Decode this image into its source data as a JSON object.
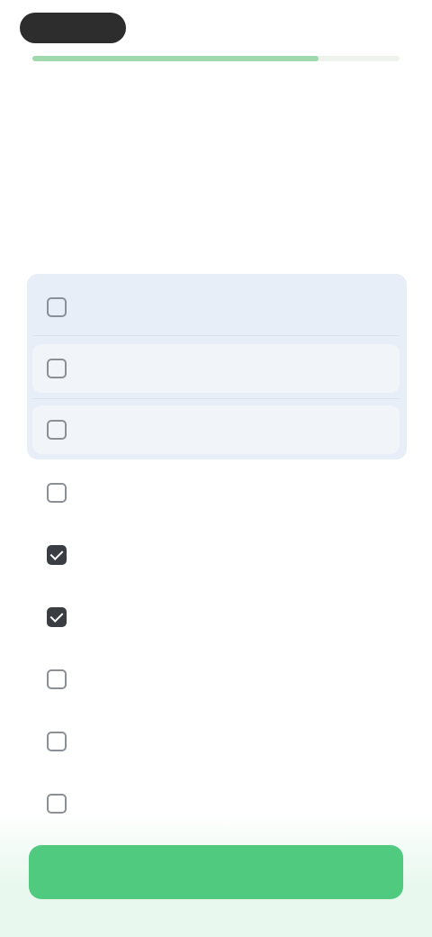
{
  "header": {
    "logo": "",
    "top_right": ""
  },
  "progress": {
    "value": 0.78
  },
  "overline": "",
  "title": "",
  "options": [
    {
      "label": "",
      "checked": false
    },
    {
      "label": "",
      "checked": false
    },
    {
      "label": "",
      "checked": false
    },
    {
      "label": "",
      "checked": false
    },
    {
      "label": "",
      "checked": true
    },
    {
      "label": "",
      "checked": true
    },
    {
      "label": "",
      "checked": false
    },
    {
      "label": "",
      "checked": false
    },
    {
      "label": "",
      "checked": false
    }
  ],
  "cta": {
    "label": ""
  },
  "colors": {
    "accent": "#4fca7f",
    "selected_box": "#e7eef7"
  }
}
